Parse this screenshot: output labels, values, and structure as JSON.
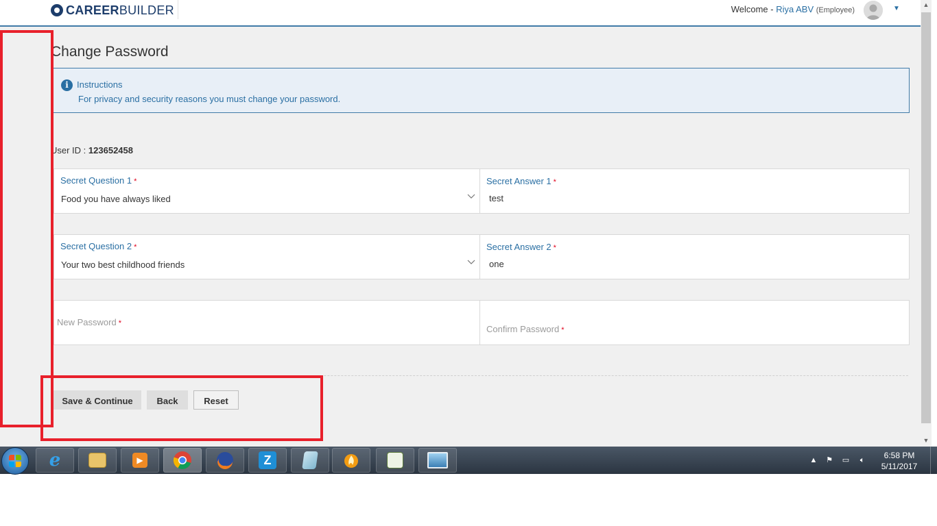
{
  "header": {
    "logo_bold": "CAREER",
    "logo_light": "BUILDER",
    "welcome_label": "Welcome -",
    "user_name": "Riya ABV",
    "user_role": "(Employee)"
  },
  "page": {
    "title": "Change Password",
    "instructions_title": "Instructions",
    "instructions_text": "For privacy and security reasons you must change your password.",
    "user_id_label": "User ID :",
    "user_id_value": "123652458"
  },
  "form": {
    "required_mark": "*",
    "secret_question_1": {
      "label": "Secret Question 1",
      "value": "Food you have always liked"
    },
    "secret_answer_1": {
      "label": "Secret Answer 1",
      "value": "test"
    },
    "secret_question_2": {
      "label": "Secret Question 2",
      "value": "Your two best childhood friends"
    },
    "secret_answer_2": {
      "label": "Secret Answer 2",
      "value": "one"
    },
    "new_password": {
      "label": "New Password",
      "value": ""
    },
    "confirm_password": {
      "label": "Confirm Password",
      "value": ""
    }
  },
  "buttons": {
    "save": "Save & Continue",
    "back": "Back",
    "reset": "Reset"
  },
  "taskbar": {
    "time": "6:58 PM",
    "date": "5/11/2017",
    "icons": [
      "internet-explorer-icon",
      "file-explorer-icon",
      "media-player-icon",
      "chrome-icon",
      "firefox-icon",
      "z-app-icon",
      "notepad-icon",
      "flame-app-icon",
      "spreadsheet-app-icon",
      "image-viewer-icon"
    ]
  },
  "colors": {
    "accent": "#2a6fa3",
    "info_bg": "#e8eff7",
    "required": "#e0001b",
    "annotation": "#e8202b"
  }
}
